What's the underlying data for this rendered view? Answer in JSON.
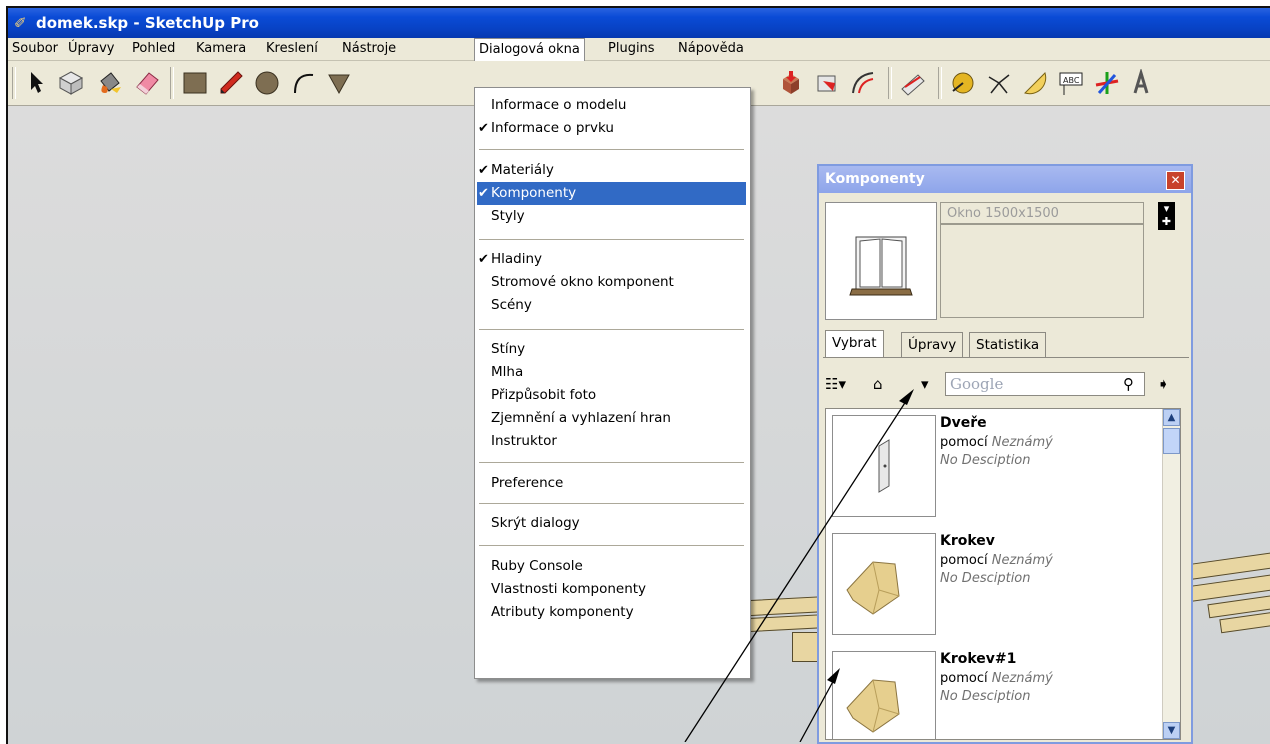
{
  "window": {
    "title": "domek.skp - SketchUp Pro",
    "app_icon": "sketchup-pencil-icon"
  },
  "menubar": [
    "Soubor",
    "Úpravy",
    "Pohled",
    "Kamera",
    "Kreslení",
    "Nástroje",
    "Dialogová okna",
    "Plugins",
    "Nápověda"
  ],
  "dropdown": {
    "groups": [
      [
        {
          "label": "Informace o modelu",
          "checked": false
        },
        {
          "label": "Informace o prvku",
          "checked": true
        }
      ],
      [
        {
          "label": "Materiály",
          "checked": true
        },
        {
          "label": "Komponenty",
          "checked": true,
          "highlighted": true
        },
        {
          "label": "Styly",
          "checked": false
        }
      ],
      [
        {
          "label": "Hladiny",
          "checked": true
        },
        {
          "label": "Stromové okno komponent",
          "checked": false
        },
        {
          "label": "Scény",
          "checked": false
        }
      ],
      [
        {
          "label": "Stíny",
          "checked": false
        },
        {
          "label": "Mlha",
          "checked": false
        },
        {
          "label": "Přizpůsobit foto",
          "checked": false
        },
        {
          "label": "Zjemnění a vyhlazení hran",
          "checked": false
        },
        {
          "label": "Instruktor",
          "checked": false
        }
      ],
      [
        {
          "label": "Preference",
          "checked": false
        }
      ],
      [
        {
          "label": "Skrýt dialogy",
          "checked": false
        }
      ],
      [
        {
          "label": "Ruby Console",
          "checked": false
        },
        {
          "label": "Vlastnosti komponenty",
          "checked": false
        },
        {
          "label": "Atributy komponenty",
          "checked": false
        }
      ]
    ]
  },
  "toolbar": {
    "icons": [
      "select-arrow-icon",
      "make-component-icon",
      "paint-bucket-icon",
      "eraser-icon",
      "rectangle-icon",
      "pencil-line-icon",
      "circle-icon",
      "arc-icon",
      "polygon-icon",
      "push-pull-icon",
      "follow-me-icon",
      "offset-icon",
      "rotate-icon",
      "tape-measure-icon",
      "dimension-icon",
      "protractor-icon",
      "text-label-icon",
      "axes-icon",
      "3d-text-icon"
    ]
  },
  "panel": {
    "title": "Komponenty",
    "name_value": "Okno 1500x1500",
    "tabs": [
      "Vybrat",
      "Úpravy",
      "Statistika"
    ],
    "search_placeholder": "Google",
    "items": [
      {
        "name": "Dveře",
        "by": "pomocí",
        "author": "Neznámý",
        "description": "No Desciption"
      },
      {
        "name": "Krokev",
        "by": "pomocí",
        "author": "Neznámý",
        "description": "No Desciption"
      },
      {
        "name": "Krokev#1",
        "by": "pomocí",
        "author": "Neznámý",
        "description": "No Desciption"
      }
    ]
  },
  "colors": {
    "titlebar": "#0a4bd6",
    "highlight": "#316ac5",
    "panel_title": "#8ea5ea",
    "wood": "#e8d6a2"
  }
}
